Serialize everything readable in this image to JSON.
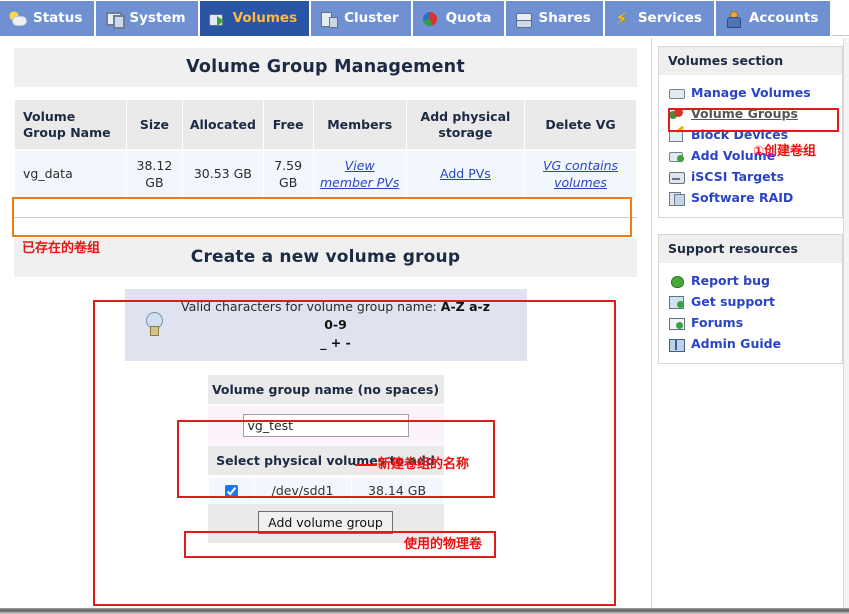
{
  "topnav": {
    "tabs": [
      {
        "label": "Status",
        "icon": "weather-status-icon",
        "active": false
      },
      {
        "label": "System",
        "icon": "monitor-system-icon",
        "active": false
      },
      {
        "label": "Volumes",
        "icon": "disk-arrow-volumes-icon",
        "active": true
      },
      {
        "label": "Cluster",
        "icon": "servers-cluster-icon",
        "active": false
      },
      {
        "label": "Quota",
        "icon": "pie-chart-quota-icon",
        "active": false
      },
      {
        "label": "Shares",
        "icon": "stacked-shares-icon",
        "active": false
      },
      {
        "label": "Services",
        "icon": "lightning-bolt-services-icon",
        "active": false
      },
      {
        "label": "Accounts",
        "icon": "user-accounts-icon",
        "active": false
      }
    ]
  },
  "main": {
    "vg_panel_title": "Volume Group Management",
    "vg_table": {
      "headers": [
        "Volume Group Name",
        "Size",
        "Allocated",
        "Free",
        "Members",
        "Add physical storage",
        "Delete VG"
      ],
      "rows": [
        {
          "name": "vg_data",
          "size": "38.12 GB",
          "allocated": "30.53 GB",
          "free": "7.59 GB",
          "members_link": "View member PVs",
          "add_storage_link": "Add PVs",
          "delete_link": "VG contains volumes"
        }
      ]
    },
    "create_panel": {
      "title": "Create a new volume group",
      "tip_prefix": "Valid characters for volume group name: ",
      "tip_chars": "A-Z a-z 0-9",
      "tip_chars2": "_ + -",
      "name_field_label": "Volume group name (no spaces)",
      "name_value": "vg_test",
      "name_placeholder": "",
      "pv_section_label": "Select physical volumes to add",
      "pv_rows": [
        {
          "checked": true,
          "device": "/dev/sdd1",
          "size": "38.14 GB"
        }
      ],
      "submit_label": "Add volume group"
    }
  },
  "sidebar": {
    "volumes_card": {
      "title": "Volumes section",
      "items": [
        {
          "label": "Manage Volumes",
          "icon": "drive-icon",
          "current": false
        },
        {
          "label": "Volume Groups",
          "icon": "volume-group-icon",
          "current": true
        },
        {
          "label": "Block Devices",
          "icon": "block-device-icon",
          "current": false
        },
        {
          "label": "Add Volume",
          "icon": "add-volume-icon",
          "current": false
        },
        {
          "label": "iSCSI Targets",
          "icon": "iscsi-target-icon",
          "current": false
        },
        {
          "label": "Software RAID",
          "icon": "software-raid-icon",
          "current": false
        }
      ]
    },
    "support_card": {
      "title": "Support resources",
      "items": [
        {
          "label": "Report bug",
          "icon": "bug-icon"
        },
        {
          "label": "Get support",
          "icon": "support-icon"
        },
        {
          "label": "Forums",
          "icon": "forum-icon"
        },
        {
          "label": "Admin Guide",
          "icon": "book-guide-icon"
        }
      ]
    }
  },
  "annotations": {
    "existing_vg": "已存在的卷组",
    "create_vg": "①创建卷组",
    "new_vg_name": "新建卷组的名称",
    "used_pv": "使用的物理卷"
  },
  "colors": {
    "nav_tab": "#7091d1",
    "nav_tab_active": "#2a55a5",
    "nav_tab_active_text": "#ffb93f",
    "link": "#2a44c8",
    "annotation_red": "#ee1111",
    "annotation_orange": "#f07c16"
  }
}
